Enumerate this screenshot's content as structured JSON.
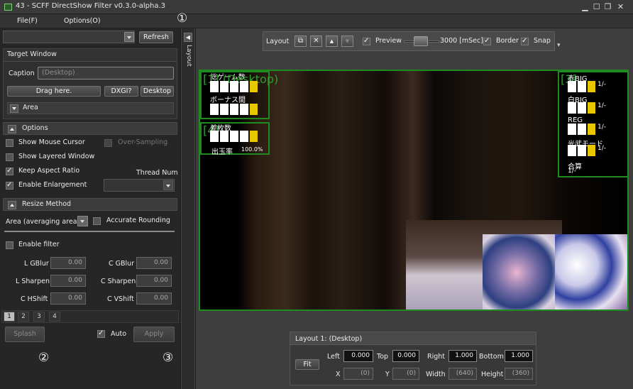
{
  "window": {
    "title": "43 - SCFF DirectShow Filter v0.3.0-alpha.3",
    "min_icon": "minimize-icon",
    "max_icon": "maximize-icon",
    "restore_icon": "restore-icon",
    "close_icon": "close-icon"
  },
  "menu": {
    "file": "File(F)",
    "options": "Options(O)"
  },
  "markers": {
    "m1": "①",
    "m2": "②",
    "m3": "③"
  },
  "top": {
    "refresh": "Refresh"
  },
  "target": {
    "header": "Target Window",
    "caption_label": "Caption",
    "caption_value": "(Desktop)",
    "drag": "Drag here.",
    "dxgi": "DXGI?",
    "desktop": "Desktop",
    "area": "Area"
  },
  "options": {
    "header": "Options",
    "show_mouse_cursor": "Show Mouse Cursor",
    "over_sampling": "Over-Sampling",
    "show_layered_window": "Show Layered Window",
    "keep_aspect_ratio": "Keep Aspect Ratio",
    "thread_num": "Thread Num",
    "enable_enlargement": "Enable Enlargement"
  },
  "resize": {
    "header": "Resize Method",
    "method": "Area (averaging area)",
    "accurate_rounding": "Accurate Rounding",
    "enable_filter": "Enable filter",
    "l_gblur": "L GBlur",
    "l_gblur_val": "0.00",
    "c_gblur": "C GBlur",
    "c_gblur_val": "0.00",
    "l_sharpen": "L Sharpen",
    "l_sharpen_val": "0.00",
    "c_sharpen": "C Sharpen",
    "c_sharpen_val": "0.00",
    "c_hshift": "C HShift",
    "c_hshift_val": "0.00",
    "c_vshift": "C VShift",
    "c_vshift_val": "0.00"
  },
  "tabs": [
    "1",
    "2",
    "3",
    "4"
  ],
  "bottom": {
    "splash": "Splash",
    "auto": "Auto",
    "apply": "Apply"
  },
  "collapse": {
    "label": "Layout",
    "arrow": "◀"
  },
  "toolbar": {
    "layout": "Layout",
    "preview": "Preview",
    "ms": "3000 [mSec]",
    "border": "Border",
    "snap": "Snap",
    "add": "⧉",
    "remove": "✕",
    "up": "▲",
    "down": "▼",
    "more": "▾"
  },
  "overlay": {
    "label1": "[1] (Desktop)",
    "total_games": "総ゲーム数",
    "bonus_between": "ボーナス間",
    "label4": "[4]",
    "medals": "差枚数",
    "payout_rate": "出玉率",
    "payout_value": "100.0%",
    "label3": "[3]",
    "red_big": "赤BIG",
    "white_big": "白BIG",
    "reg": "REG",
    "mode": "光武モード",
    "total": "合算",
    "ratio": "1/-"
  },
  "layoutpanel": {
    "header": "Layout 1: (Desktop)",
    "fit": "Fit",
    "left": "Left",
    "left_val": "0.000",
    "top": "Top",
    "top_val": "0.000",
    "right": "Right",
    "right_val": "1.000",
    "bottom": "Bottom",
    "bottom_val": "1.000",
    "x": "X",
    "x_val": "(0)",
    "y": "Y",
    "y_val": "(0)",
    "width": "Width",
    "width_val": "(640)",
    "height": "Height",
    "height_val": "(360)"
  }
}
